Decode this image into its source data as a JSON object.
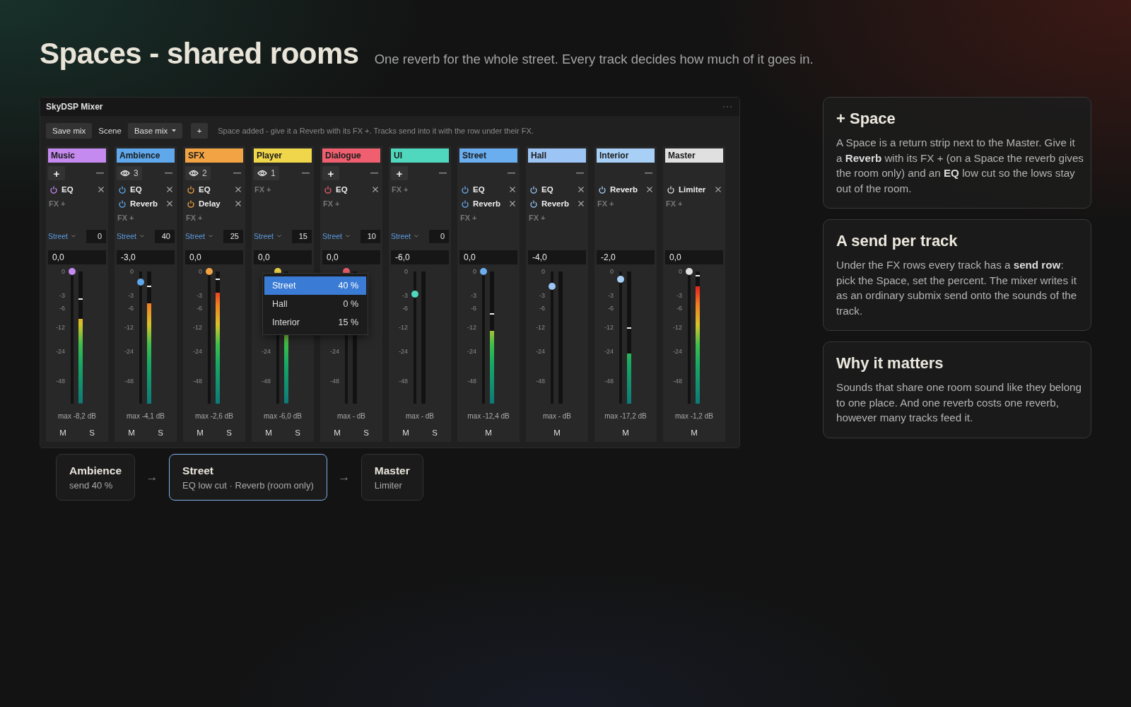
{
  "title": "Spaces - shared rooms",
  "subtitle": "One reverb for the whole street. Every track decides how much of it goes in.",
  "mixer": {
    "title": "SkyDSP Mixer",
    "toolbar": {
      "save": "Save mix",
      "scene_label": "Scene",
      "scene": "Base mix",
      "add": "+",
      "hint": "Space added - give it a Reverb with its FX +. Tracks send into it with the row under their FX."
    },
    "strips": [
      {
        "name": "Music",
        "color": "#c58af0",
        "header": {
          "kind": "add",
          "label": "+"
        },
        "removable": true,
        "fx": [
          {
            "name": "EQ"
          }
        ],
        "fx_add": "FX +",
        "send": {
          "target": "Street",
          "value": "0"
        },
        "volume": "0,0",
        "scale": [
          "0",
          "-3",
          "-6",
          "-12",
          "-24",
          "-48"
        ],
        "fader": {
          "level": 1.0
        },
        "meter": {
          "level": 0.64,
          "hold": {
            "level": 0.79
          }
        },
        "max": "max -8,2 dB",
        "buttons": [
          "M",
          "S"
        ]
      },
      {
        "name": "Ambience",
        "color": "#5fa8ec",
        "header": {
          "kind": "count",
          "label": "3"
        },
        "removable": true,
        "fx": [
          {
            "name": "EQ"
          },
          {
            "name": "Reverb"
          }
        ],
        "fx_add": "FX +",
        "send": {
          "target": "Street",
          "value": "40"
        },
        "volume": "-3,0",
        "scale": [
          "0",
          "-3",
          "-6",
          "-12",
          "-24",
          "-48"
        ],
        "fader": {
          "level": 0.92
        },
        "meter": {
          "level": 0.76,
          "hold": {
            "level": 0.89
          }
        },
        "max": "max -4,1 dB",
        "buttons": [
          "M",
          "S"
        ]
      },
      {
        "name": "SFX",
        "color": "#f2a444",
        "header": {
          "kind": "count",
          "label": "2"
        },
        "removable": true,
        "fx": [
          {
            "name": "EQ"
          },
          {
            "name": "Delay"
          }
        ],
        "fx_add": "FX +",
        "send": {
          "target": "Street",
          "value": "25"
        },
        "volume": "0,0",
        "scale": [
          "0",
          "-3",
          "-6",
          "-12",
          "-24",
          "-48"
        ],
        "fader": {
          "level": 1.0
        },
        "meter": {
          "level": 0.84,
          "hold": {
            "level": 0.94
          }
        },
        "max": "max -2,6 dB",
        "buttons": [
          "M",
          "S"
        ]
      },
      {
        "name": "Player",
        "color": "#f0d64a",
        "header": {
          "kind": "count",
          "label": "1"
        },
        "removable": true,
        "fx_add": "FX +",
        "send": {
          "target": "Street",
          "value": "15"
        },
        "volume": "0,0",
        "scale": [
          "-24",
          "-48"
        ],
        "fader": {
          "level": 1.0
        },
        "meter": {
          "level": 0.72
        },
        "max": "max -6,0 dB",
        "buttons": [
          "M",
          "S"
        ],
        "menu": [
          {
            "label": "Street",
            "value": "40 %",
            "selected": true
          },
          {
            "label": "Hall",
            "value": "0 %",
            "selected": false
          },
          {
            "label": "Interior",
            "value": "15 %",
            "selected": false
          }
        ]
      },
      {
        "name": "Dialogue",
        "color": "#ef5f6f",
        "header": {
          "kind": "add",
          "label": "+"
        },
        "removable": true,
        "fx": [
          {
            "name": "EQ"
          }
        ],
        "fx_add": "FX +",
        "send": {
          "target": "Street",
          "value": "10"
        },
        "volume": "0,0",
        "scale": [
          "-24",
          "-48"
        ],
        "fader": {
          "level": 1.0
        },
        "max": "max - dB",
        "buttons": [
          "M",
          "S"
        ]
      },
      {
        "name": "UI",
        "color": "#4fd8be",
        "header": {
          "kind": "add",
          "label": "+"
        },
        "removable": true,
        "fx_add": "FX +",
        "send": {
          "target": "Street",
          "value": "0"
        },
        "volume": "-6,0",
        "scale": [
          "0",
          "-3",
          "-6",
          "-12",
          "-24",
          "-48"
        ],
        "fader": {
          "level": 0.83
        },
        "max": "max - dB",
        "buttons": [
          "M",
          "S"
        ]
      },
      {
        "name": "Street",
        "color": "#6aaef0",
        "header": {
          "kind": "none"
        },
        "removable": true,
        "fx": [
          {
            "name": "EQ"
          },
          {
            "name": "Reverb"
          }
        ],
        "fx_add": "FX +",
        "volume": "0,0",
        "scale": [
          "0",
          "-3",
          "-6",
          "-12",
          "-24",
          "-48"
        ],
        "fader": {
          "level": 1.0
        },
        "meter": {
          "level": 0.55,
          "hold": {
            "level": 0.68
          }
        },
        "max": "max -12,4 dB",
        "buttons": [
          "M"
        ]
      },
      {
        "name": "Hall",
        "color": "#9cc4f4",
        "header": {
          "kind": "none"
        },
        "removable": true,
        "fx": [
          {
            "name": "EQ"
          },
          {
            "name": "Reverb"
          }
        ],
        "fx_add": "FX +",
        "volume": "-4,0",
        "scale": [
          "0",
          "-3",
          "-6",
          "-12",
          "-24",
          "-48"
        ],
        "fader": {
          "level": 0.89
        },
        "max": "max - dB",
        "buttons": [
          "M"
        ]
      },
      {
        "name": "Interior",
        "color": "#a8d0f6",
        "header": {
          "kind": "none"
        },
        "removable": true,
        "fx": [
          {
            "name": "Reverb"
          }
        ],
        "fx_add": "FX +",
        "volume": "-2,0",
        "scale": [
          "0",
          "-3",
          "-6",
          "-12",
          "-24",
          "-48"
        ],
        "fader": {
          "level": 0.94
        },
        "meter": {
          "level": 0.38,
          "hold": {
            "level": 0.57
          }
        },
        "max": "max -17,2 dB",
        "buttons": [
          "M"
        ]
      },
      {
        "name": "Master",
        "color": "#e0e0e0",
        "header": {
          "kind": "none"
        },
        "removable": false,
        "fx": [
          {
            "name": "Limiter"
          }
        ],
        "fx_add": "FX +",
        "volume": "0,0",
        "scale": [
          "0",
          "-3",
          "-6",
          "-12",
          "-24",
          "-48"
        ],
        "fader": {
          "level": 1.0
        },
        "meter": {
          "level": 0.89,
          "hold": {
            "level": 0.97
          }
        },
        "max": "max -1,2 dB",
        "buttons": [
          "M"
        ]
      }
    ]
  },
  "flow": [
    {
      "kind": "node",
      "title": "Ambience",
      "detail": "send 40 %",
      "selected": false
    },
    {
      "kind": "arrow",
      "label": "→"
    },
    {
      "kind": "node",
      "title": "Street",
      "detail": "EQ low cut · Reverb (room only)",
      "selected": true
    },
    {
      "kind": "arrow",
      "label": "→"
    },
    {
      "kind": "node",
      "title": "Master",
      "detail": "Limiter",
      "selected": false
    }
  ],
  "cards": [
    {
      "title": "+ Space",
      "body": "A Space is a return strip next to the Master. Give it a **Reverb** with its FX + (on a Space the reverb gives the room only) and an **EQ** low cut so the lows stay out of the room."
    },
    {
      "title": "A send per track",
      "body": "Under the FX rows every track has a **send row**: pick the Space, set the percent. The mixer writes it as an ordinary submix send onto the sounds of the track."
    },
    {
      "title": "Why it matters",
      "body": "Sounds that share one room sound like they belong to one place. And one reverb costs one reverb, however many tracks feed it."
    }
  ]
}
